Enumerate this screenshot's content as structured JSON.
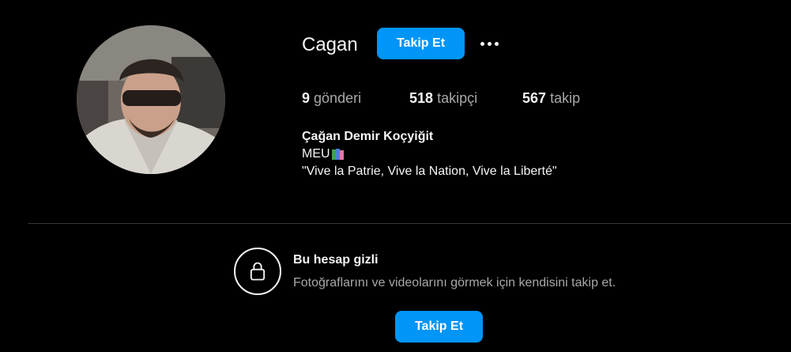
{
  "profile": {
    "username": "Cagan",
    "follow_label": "Takip Et",
    "more_icon": "more-horizontal-icon",
    "avatar_alt": "profile-photo"
  },
  "stats": {
    "posts_count": "9",
    "posts_label": "gönderi",
    "followers_count": "518",
    "followers_label": "takipçi",
    "following_count": "567",
    "following_label": "takip"
  },
  "bio": {
    "full_name": "Çağan Demir Koçyiğit",
    "line2_text": "MEU",
    "line2_emoji": "books-emoji",
    "line3": "\"Vive la Patrie, Vive la Nation, Vive la Liberté\""
  },
  "private": {
    "icon": "lock-icon",
    "title": "Bu hesap gizli",
    "description": "Fotoğraflarını ve videolarını görmek için kendisini takip et.",
    "follow_label": "Takip Et"
  },
  "colors": {
    "background": "#000000",
    "primary_text": "#f5f5f5",
    "secondary_text": "#a8a8a8",
    "accent": "#0095f6",
    "divider": "#363636"
  }
}
